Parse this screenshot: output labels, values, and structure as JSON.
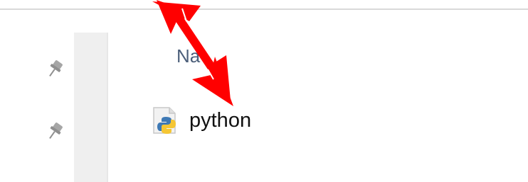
{
  "list": {
    "column_header": "Na",
    "items": [
      {
        "name": "python",
        "icon": "python-file-icon"
      }
    ]
  },
  "quick_access": {
    "pins": [
      {
        "icon": "pin-icon"
      },
      {
        "icon": "pin-icon"
      }
    ]
  },
  "annotation": {
    "kind": "red double-headed arrow (hand-drawn markup)",
    "color": "#ff0000"
  }
}
